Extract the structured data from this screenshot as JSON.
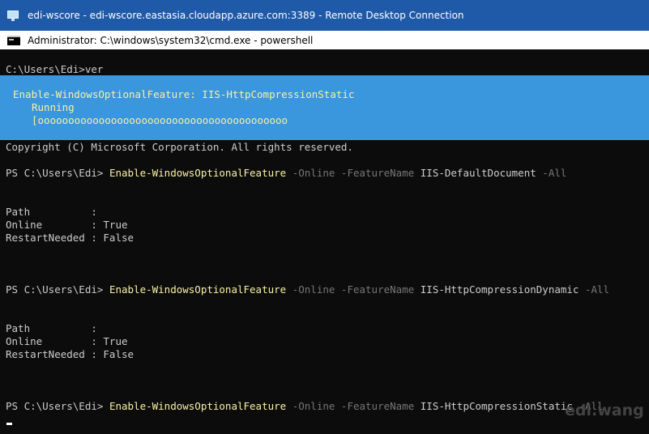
{
  "rdp_window": {
    "title": "edi-wscore - edi-wscore.eastasia.cloudapp.azure.com:3389 - Remote Desktop Connection",
    "icon": "remote-desktop-icon"
  },
  "console_window": {
    "title": "Administrator: C:\\windows\\system32\\cmd.exe - powershell",
    "icon": "cmd-icon"
  },
  "progress": {
    "activity": "Enable-WindowsOptionalFeature: IIS-HttpCompressionStatic",
    "status": "Running",
    "bar": "[ooooooooooooooooooooooooooooooooooooooooo"
  },
  "console": {
    "ver_command": "C:\\Users\\Edi>ver",
    "copyright": "Copyright (C) Microsoft Corporation. All rights reserved.",
    "commands": [
      {
        "prompt": "PS C:\\Users\\Edi> ",
        "cmdlet": "Enable-WindowsOptionalFeature",
        "param_online": " -Online",
        "param_featurename": " -FeatureName",
        "feature": " IIS-DefaultDocument",
        "param_all": " -All"
      },
      {
        "prompt": "PS C:\\Users\\Edi> ",
        "cmdlet": "Enable-WindowsOptionalFeature",
        "param_online": " -Online",
        "param_featurename": " -FeatureName",
        "feature": " IIS-HttpCompressionDynamic",
        "param_all": " -All"
      },
      {
        "prompt": "PS C:\\Users\\Edi> ",
        "cmdlet": "Enable-WindowsOptionalFeature",
        "param_online": " -Online",
        "param_featurename": " -FeatureName",
        "feature": " IIS-HttpCompressionStatic",
        "param_all": " -All"
      }
    ],
    "results": [
      {
        "path": "Path          :",
        "online": "Online        : True",
        "restart": "RestartNeeded : False"
      },
      {
        "path": "Path          :",
        "online": "Online        : True",
        "restart": "RestartNeeded : False"
      }
    ]
  },
  "watermark": "edi.wang",
  "colors": {
    "rdp_titlebar": "#1f5aa8",
    "console_bg": "#0c0c0c",
    "progress_bg": "#3a96dd",
    "cmdlet": "#f9f1a5",
    "parameter": "#767676",
    "text": "#cccccc"
  }
}
